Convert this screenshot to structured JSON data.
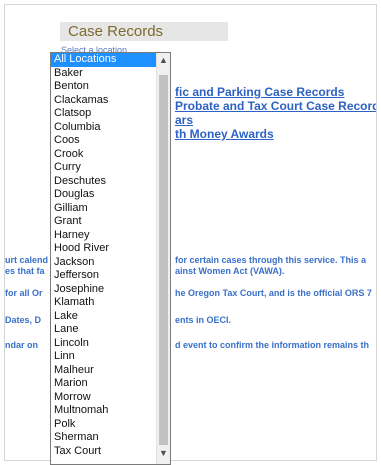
{
  "header": {
    "title": "Case Records",
    "location_label": "Select a location"
  },
  "links": [
    "fic and Parking Case Records",
    "Probate and Tax Court Case Records",
    "ars",
    "th Money Awards"
  ],
  "notes": [
    "urt calend",
    "es that fa",
    "for certain cases through this service. This a",
    "ainst Women Act (VAWA).",
    "for all Or",
    "he Oregon Tax Court, and is the official ORS 7",
    "Dates, D",
    "ents in OECI.",
    "ndar on",
    "d event to confirm the information remains th"
  ],
  "location_dropdown": {
    "selected": "All Locations",
    "options": [
      "All Locations",
      "Baker",
      "Benton",
      "Clackamas",
      "Clatsop",
      "Columbia",
      "Coos",
      "Crook",
      "Curry",
      "Deschutes",
      "Douglas",
      "Gilliam",
      "Grant",
      "Harney",
      "Hood River",
      "Jackson",
      "Jefferson",
      "Josephine",
      "Klamath",
      "Lake",
      "Lane",
      "Lincoln",
      "Linn",
      "Malheur",
      "Marion",
      "Morrow",
      "Multnomah",
      "Polk",
      "Sherman",
      "Tax Court"
    ]
  },
  "icons": {
    "scroll_up": "chevron-up-icon",
    "scroll_down": "chevron-down-icon"
  }
}
